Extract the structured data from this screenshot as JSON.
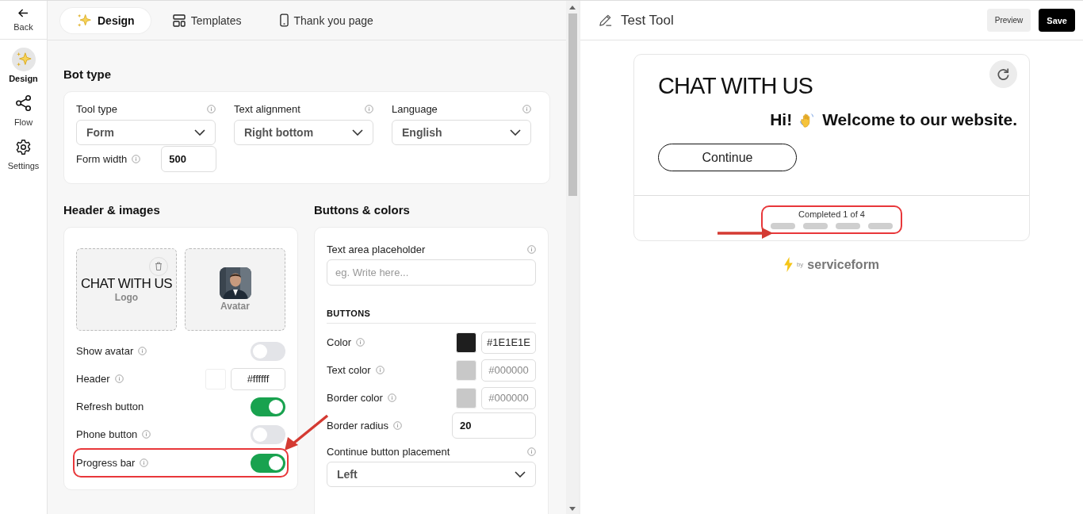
{
  "sidebar": {
    "back": "Back",
    "items": [
      {
        "label": "Design",
        "kind": "sparkle",
        "selected": true
      },
      {
        "label": "Flow",
        "kind": "share",
        "selected": false
      },
      {
        "label": "Settings",
        "kind": "gear",
        "selected": false
      }
    ]
  },
  "tabs": [
    {
      "label": "Design",
      "kind": "sparkle",
      "selected": true
    },
    {
      "label": "Templates",
      "kind": "layout",
      "selected": false
    },
    {
      "label": "Thank you page",
      "kind": "phone",
      "selected": false
    }
  ],
  "bot_type": {
    "title": "Bot type",
    "fields": [
      {
        "label": "Tool type",
        "value": "Form"
      },
      {
        "label": "Text alignment",
        "value": "Right bottom"
      },
      {
        "label": "Language",
        "value": "English"
      }
    ],
    "form_width": {
      "label": "Form width",
      "value": "500"
    }
  },
  "header_images": {
    "title": "Header & images",
    "logo": {
      "text": "CHAT WITH US",
      "label": "Logo"
    },
    "avatar": {
      "label": "Avatar",
      "kind": "picture"
    },
    "rows": [
      {
        "kind": "toggle",
        "label": "Show avatar",
        "info": true,
        "on": false,
        "highlighted": false
      },
      {
        "kind": "color",
        "label": "Header",
        "info": true,
        "value": "#ffffff",
        "disabled": false
      },
      {
        "kind": "toggle",
        "label": "Refresh button",
        "info": false,
        "on": true,
        "highlighted": false
      },
      {
        "kind": "toggle",
        "label": "Phone button",
        "info": true,
        "on": false,
        "highlighted": false
      },
      {
        "kind": "toggle",
        "label": "Progress bar",
        "info": true,
        "on": true,
        "highlighted": true
      }
    ]
  },
  "buttons_colors": {
    "title": "Buttons & colors",
    "placeholder_field": {
      "label": "Text area placeholder",
      "placeholder": "eg. Write here..."
    },
    "section": "BUTTONS",
    "rows": [
      {
        "kind": "color",
        "label": "Color",
        "info": true,
        "value": "#1E1E1E",
        "disabled": false
      },
      {
        "kind": "color",
        "label": "Text color",
        "info": true,
        "value": "#000000",
        "disabled": true
      },
      {
        "kind": "color",
        "label": "Border color",
        "info": true,
        "value": "#000000",
        "disabled": true
      },
      {
        "kind": "number",
        "label": "Border radius",
        "info": true,
        "value": "20"
      },
      {
        "kind": "select",
        "label": "Continue button placement",
        "info": true,
        "value": "Left"
      }
    ]
  },
  "preview": {
    "title": "Test Tool",
    "buttons": [
      {
        "label": "Preview",
        "kind": "secondary"
      },
      {
        "label": "Save",
        "kind": "primary"
      }
    ],
    "card": {
      "heading": "CHAT WITH US",
      "greeting": "Hi!",
      "message": "Welcome to our website.",
      "continue": "Continue",
      "progress": {
        "text": "Completed 1 of 4",
        "highlighted": true,
        "steps": [
          {
            "filled": false
          },
          {
            "filled": false
          },
          {
            "filled": false
          },
          {
            "filled": false
          }
        ]
      }
    },
    "footer": {
      "by": "by",
      "brand": "serviceform"
    }
  }
}
